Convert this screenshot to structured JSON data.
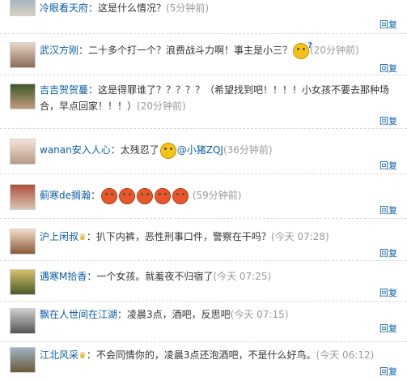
{
  "reply_label": "回复",
  "comments": [
    {
      "user": "冷眼看天府",
      "content": "这是什么情况？",
      "time": "(5分钟前)"
    },
    {
      "user": "武汉方刚",
      "content": "二十多个打一个？浪费战斗力啊！事主是小三？",
      "time": "(20分钟前)"
    },
    {
      "user": "吉吉贺贺蔓",
      "content": "这是得罪谁了？？？？？（希望找到吧！！！！小女孩不要去那种场合，早点回家！！！）",
      "time": "(20分钟前)"
    },
    {
      "user": "wanan安入人心",
      "content": "太残忍了",
      "mention": "@小猪ZQJ",
      "time": "(36分钟前)"
    },
    {
      "user": "蓟寒de搁瀚",
      "content": "",
      "time": "(59分钟前)"
    },
    {
      "user": "沪上闲叔",
      "content": "扒下内裤，恶性刑事口件，警察在干吗？",
      "time": "(今天 07:28)"
    },
    {
      "user": "遇寒M拾香",
      "content": "一个女孩。就羞夜不归宿了",
      "time": "(今天 07:25)"
    },
    {
      "user": "飘在人世间在江湖",
      "content": "凌晨3点，酒吧，反思吧",
      "time": "(今天 07:15)"
    },
    {
      "user": "江北风采",
      "content": "不会同情你的，凌晨3点还泡酒吧，不是什么好鸟。",
      "time": "(今天 06:12)"
    }
  ]
}
